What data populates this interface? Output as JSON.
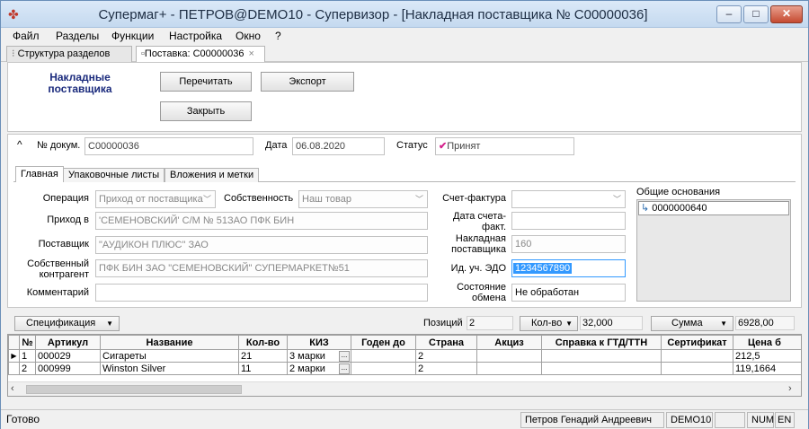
{
  "window": {
    "title": "Супермаг+ - ПЕТРОВ@DEMO10 - Супервизор  - [Накладная поставщика № C00000036]",
    "minimize_label": "–",
    "maximize_label": "□",
    "close_label": "✕"
  },
  "menu": [
    "Файл",
    "Разделы",
    "Функции",
    "Настройка",
    "Окно",
    "?"
  ],
  "doc_tabs": [
    {
      "label": "Структура разделов"
    },
    {
      "label": "Поставка: C00000036",
      "close": "×"
    }
  ],
  "top_panel": {
    "title": "Накладные поставщика",
    "refresh_label": "Перечитать",
    "export_label": "Экспорт",
    "close_label": "Закрыть"
  },
  "header": {
    "collapse_glyph": "^",
    "doc_no_label": "№ докум.",
    "doc_no": "C00000036",
    "date_label": "Дата",
    "date": "06.08.2020",
    "status_label": "Статус",
    "status_check": "✔",
    "status": "Принят"
  },
  "inner_tabs": [
    "Главная",
    "Упаковочные листы",
    "Вложения и метки"
  ],
  "form": {
    "operation_label": "Операция",
    "operation": "Приход от поставщика",
    "ownership_label": "Собственность",
    "ownership": "Наш товар",
    "arrival_label": "Приход в",
    "arrival": "'СЕМЕНОВСКИЙ' С/М № 51ЗАО ПФК БИН",
    "supplier_label": "Поставщик",
    "supplier": "\"АУДИКОН ПЛЮС\" ЗАО",
    "own_counterparty_label": "Собственный контрагент",
    "own_counterparty": "ПФК БИН ЗАО \"СЕМЕНОВСКИЙ\" СУПЕРМАРКЕТ№51",
    "comment_label": "Комментарий",
    "comment": "",
    "invoice_label": "Счет-фактура",
    "invoice": "",
    "invoice_date_label": "Дата счета-факт.",
    "invoice_date": "",
    "supplier_invoice_label": "Накладная поставщика",
    "supplier_invoice": "160",
    "edo_id_label": "Ид. уч. ЭДО",
    "edo_id": "1234567890",
    "exchange_state_label": "Состояние обмена",
    "exchange_state": "Не обработан",
    "common_grounds_label": "Общие основания",
    "common_grounds": [
      "0000000640"
    ]
  },
  "spec_bar": {
    "spec_label": "Спецификация",
    "positions_label": "Позиций",
    "positions": "2",
    "qty_button": "Кол-во",
    "qty_value": "32,000",
    "sum_button": "Сумма",
    "sum_value": "6928,00"
  },
  "table": {
    "columns": [
      "",
      "№",
      "Артикул",
      "Название",
      "Кол-во",
      "КИЗ",
      "Годен до",
      "Страна",
      "Акциз",
      "Справка к ГТД/ТТН",
      "Сертификат",
      "Цена б"
    ],
    "rows": [
      {
        "marker": "▶",
        "no": "1",
        "article": "000029",
        "name": "Сигареты",
        "qty": "21",
        "kiz": "3 марки",
        "expiry": "",
        "country": "2",
        "excise": "",
        "gtd": "",
        "cert": "",
        "price": "212,5"
      },
      {
        "marker": "",
        "no": "2",
        "article": "000999",
        "name": "Winston Silver",
        "qty": "11",
        "kiz": "2 марки",
        "expiry": "",
        "country": "2",
        "excise": "",
        "gtd": "",
        "cert": "",
        "price": "119,1664"
      }
    ]
  },
  "status_bar": {
    "ready": "Готово",
    "user": "Петров Генадий Андреевич",
    "db": "DEMO10",
    "num": "NUM",
    "lang": "EN"
  },
  "colors": {
    "panel_title": "#1b2b7d",
    "status_check": "#d4208c",
    "selection": "#3399ff",
    "title_bar": "#c4d9ef"
  }
}
